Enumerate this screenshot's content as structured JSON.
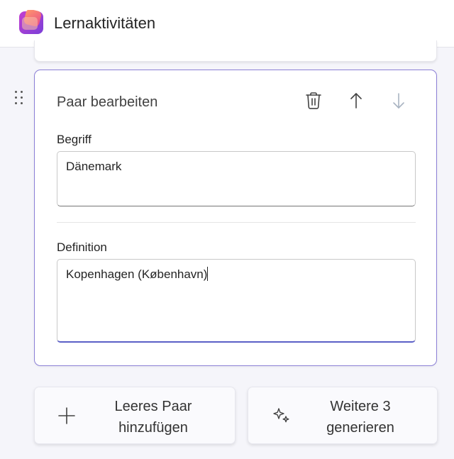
{
  "header": {
    "title": "Lernaktivitäten",
    "logo_icon": "learning-activities-logo-icon"
  },
  "edit_card": {
    "title": "Paar bearbeiten",
    "actions": [
      {
        "name": "delete",
        "icon": "trash-icon",
        "enabled": true
      },
      {
        "name": "move-up",
        "icon": "arrow-up-icon",
        "enabled": true
      },
      {
        "name": "move-down",
        "icon": "arrow-down-icon",
        "enabled": false
      }
    ],
    "term": {
      "label": "Begriff",
      "value": "Dänemark"
    },
    "definition": {
      "label": "Definition",
      "value": "Kopenhagen (København)"
    }
  },
  "buttons": {
    "add_empty": {
      "label_line1": "Leeres Paar",
      "label_line2": "hinzufügen",
      "icon": "plus-icon"
    },
    "generate_more": {
      "label_line1": "Weitere 3",
      "label_line2": "generieren",
      "icon": "sparkle-icon"
    }
  },
  "colors": {
    "accent": "#5b5fc7",
    "card_border": "#8b7fd6",
    "background": "#f5f5fa",
    "disabled_icon": "#a9b4c2"
  }
}
